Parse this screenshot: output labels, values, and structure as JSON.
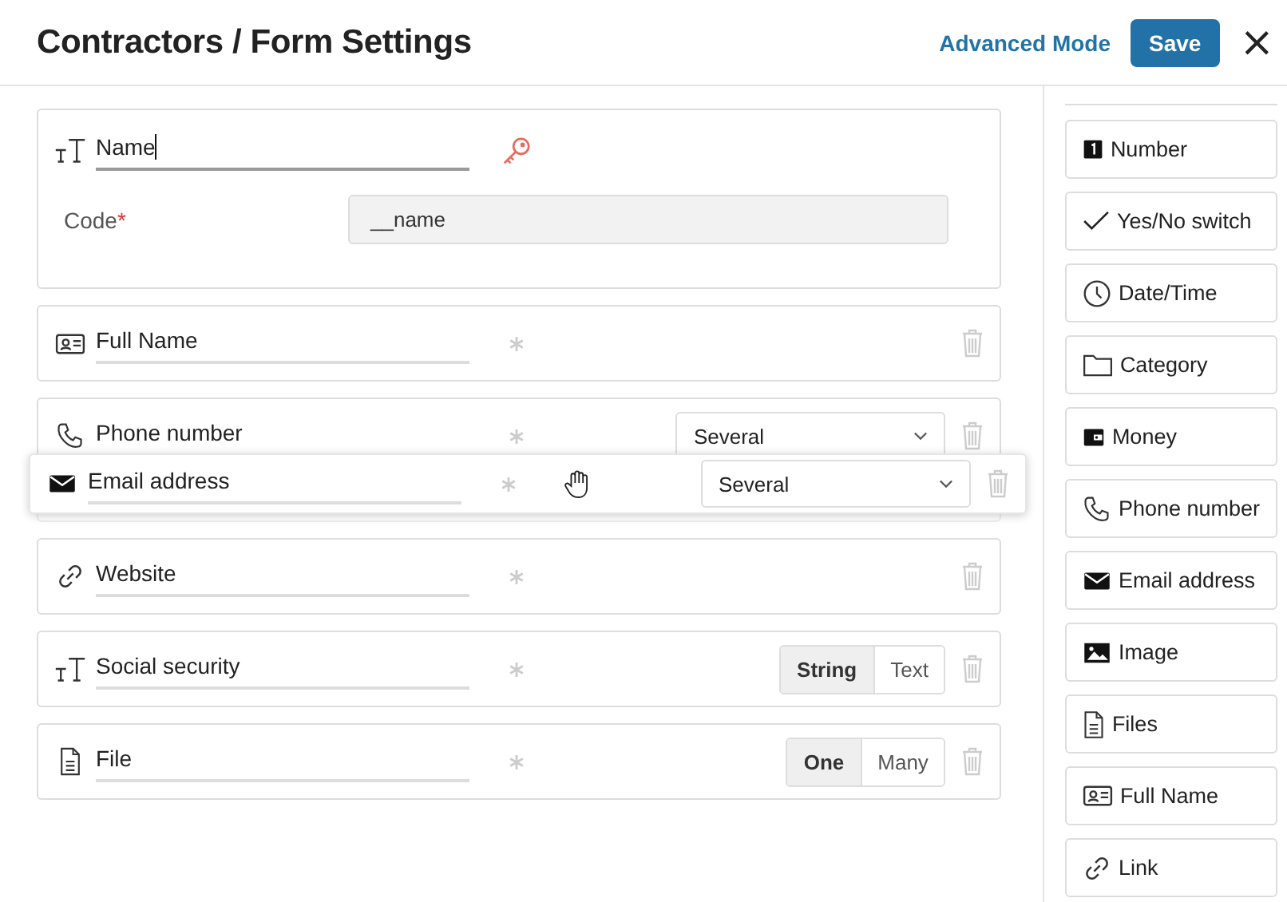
{
  "title": "Contractors / Form Settings",
  "advanced_mode": "Advanced Mode",
  "save": "Save",
  "close": "×",
  "name_field": {
    "value": "Name",
    "code_label": "Code",
    "required_mark": "*",
    "code_value": "__name"
  },
  "fields": [
    {
      "label": "Full Name",
      "kind": "plain"
    },
    {
      "label": "Phone number",
      "kind": "select",
      "value": "Several"
    },
    {
      "label": "Website",
      "kind": "plain"
    },
    {
      "label": "Social security",
      "kind": "toggle",
      "options": [
        {
          "label": "String",
          "selected": true
        },
        {
          "label": "Text",
          "selected": false
        }
      ]
    },
    {
      "label": "File",
      "kind": "toggle",
      "options": [
        {
          "label": "One",
          "selected": true
        },
        {
          "label": "Many",
          "selected": false
        }
      ]
    }
  ],
  "dragged_field": {
    "label": "Email address",
    "kind": "select",
    "value": "Several"
  },
  "palette": [
    {
      "label": "Number"
    },
    {
      "label": "Yes/No switch"
    },
    {
      "label": "Date/Time"
    },
    {
      "label": "Category"
    },
    {
      "label": "Money"
    },
    {
      "label": "Phone number"
    },
    {
      "label": "Email address"
    },
    {
      "label": "Image"
    },
    {
      "label": "Files"
    },
    {
      "label": "Full Name"
    },
    {
      "label": "Link"
    }
  ]
}
